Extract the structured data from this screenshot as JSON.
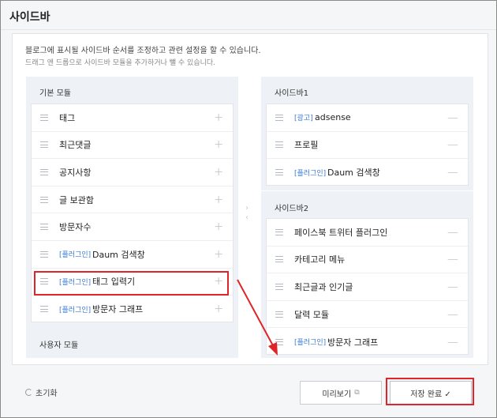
{
  "header": {
    "title": "사이드바"
  },
  "description": {
    "line1": "블로그에 표시될 사이드바 순서를 조정하고 관련 설정을 할 수 있습니다.",
    "line2": "드래그 앤 드롭으로 사이드바 모듈을 추가하거나 뺄 수 있습니다."
  },
  "left": {
    "basic_title": "기본 모듈",
    "user_title": "사용자 모듈",
    "add_symbol": "+",
    "items": [
      {
        "tag": "",
        "label": "태그"
      },
      {
        "tag": "",
        "label": "최근댓글"
      },
      {
        "tag": "",
        "label": "공지사항"
      },
      {
        "tag": "",
        "label": "글 보관함"
      },
      {
        "tag": "",
        "label": "방문자수"
      },
      {
        "tag": "[플러그인]",
        "label": "Daum 검색창"
      },
      {
        "tag": "[플러그인]",
        "label": "태그 입력기"
      },
      {
        "tag": "[플러그인]",
        "label": "방문자 그래프"
      }
    ]
  },
  "right": {
    "remove_symbol": "—",
    "sidebar1": {
      "title": "사이드바1",
      "items": [
        {
          "tag": "[광고]",
          "label": "adsense"
        },
        {
          "tag": "",
          "label": "프로필"
        },
        {
          "tag": "[플러그인]",
          "label": "Daum 검색창"
        }
      ]
    },
    "sidebar2": {
      "title": "사이드바2",
      "items": [
        {
          "tag": "",
          "label": "페이스북 트위터 플러그인"
        },
        {
          "tag": "",
          "label": "카테고리 메뉴"
        },
        {
          "tag": "",
          "label": "최근글과 인기글"
        },
        {
          "tag": "",
          "label": "달력 모듈"
        },
        {
          "tag": "[플러그인]",
          "label": "방문자 그래프"
        }
      ]
    }
  },
  "footer": {
    "reset_label": "초기화",
    "preview_label": "미리보기",
    "preview_icon": "external-link-icon",
    "save_label": "저장 완료 ✓"
  },
  "colors": {
    "plugin_tag": "#3a7bd5",
    "highlight": "#e0252a"
  }
}
